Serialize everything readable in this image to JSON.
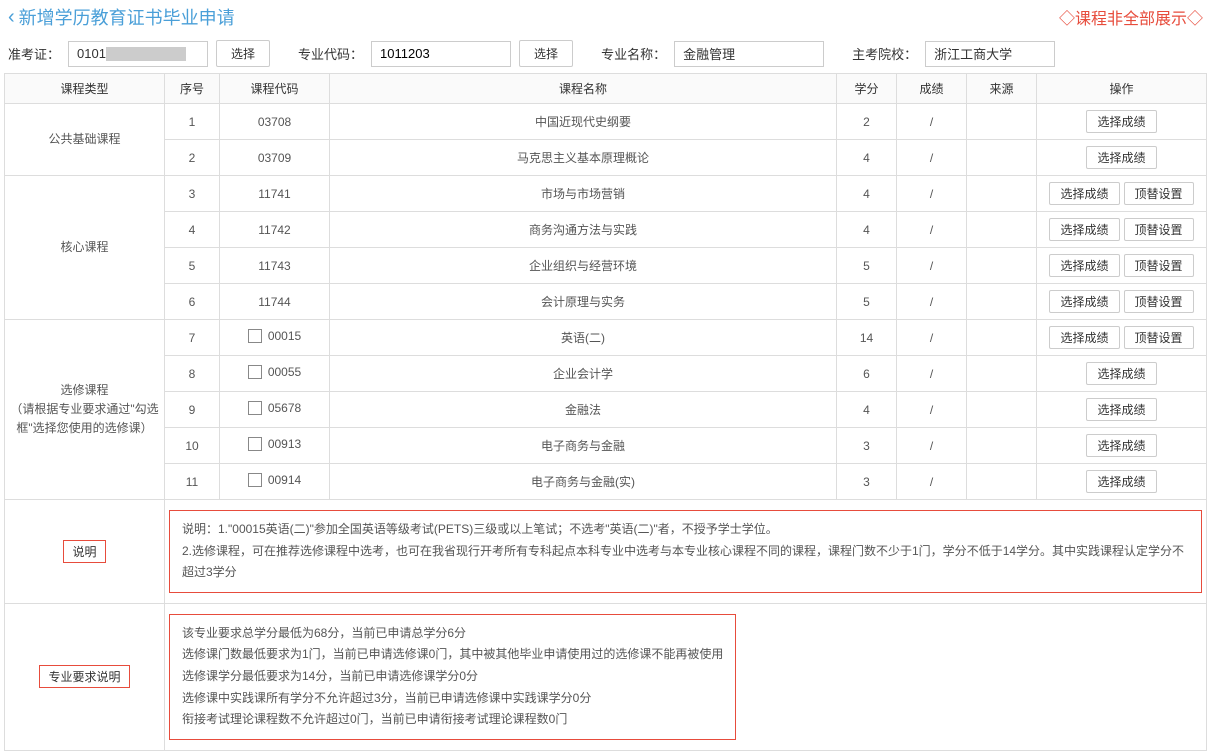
{
  "header": {
    "title": "新增学历教育证书毕业申请",
    "warning": "◇课程非全部展示◇"
  },
  "form": {
    "exam_id_label": "准考证：",
    "exam_id_value": "0101",
    "select_btn": "选择",
    "major_code_label": "专业代码：",
    "major_code_value": "1011203",
    "major_name_label": "专业名称：",
    "major_name_value": "金融管理",
    "school_label": "主考院校：",
    "school_value": "浙江工商大学"
  },
  "table": {
    "headers": {
      "type": "课程类型",
      "seq": "序号",
      "code": "课程代码",
      "name": "课程名称",
      "credit": "学分",
      "score": "成绩",
      "source": "来源",
      "action": "操作"
    },
    "groups": [
      {
        "type": "公共基础课程",
        "rows": [
          {
            "seq": "1",
            "code": "03708",
            "name": "中国近现代史纲要",
            "credit": "2",
            "score": "/",
            "source": "",
            "checkbox": false,
            "sub": false
          },
          {
            "seq": "2",
            "code": "03709",
            "name": "马克思主义基本原理概论",
            "credit": "4",
            "score": "/",
            "source": "",
            "checkbox": false,
            "sub": false
          }
        ]
      },
      {
        "type": "核心课程",
        "rows": [
          {
            "seq": "3",
            "code": "11741",
            "name": "市场与市场营销",
            "credit": "4",
            "score": "/",
            "source": "",
            "checkbox": false,
            "sub": true
          },
          {
            "seq": "4",
            "code": "11742",
            "name": "商务沟通方法与实践",
            "credit": "4",
            "score": "/",
            "source": "",
            "checkbox": false,
            "sub": true
          },
          {
            "seq": "5",
            "code": "11743",
            "name": "企业组织与经营环境",
            "credit": "5",
            "score": "/",
            "source": "",
            "checkbox": false,
            "sub": true
          },
          {
            "seq": "6",
            "code": "11744",
            "name": "会计原理与实务",
            "credit": "5",
            "score": "/",
            "source": "",
            "checkbox": false,
            "sub": true
          }
        ]
      },
      {
        "type": "选修课程\n（请根据专业要求通过\"勾选框\"选择您使用的选修课）",
        "rows": [
          {
            "seq": "7",
            "code": "00015",
            "name": "英语(二)",
            "credit": "14",
            "score": "/",
            "source": "",
            "checkbox": true,
            "sub": true
          },
          {
            "seq": "8",
            "code": "00055",
            "name": "企业会计学",
            "credit": "6",
            "score": "/",
            "source": "",
            "checkbox": true,
            "sub": false
          },
          {
            "seq": "9",
            "code": "05678",
            "name": "金融法",
            "credit": "4",
            "score": "/",
            "source": "",
            "checkbox": true,
            "sub": false
          },
          {
            "seq": "10",
            "code": "00913",
            "name": "电子商务与金融",
            "credit": "3",
            "score": "/",
            "source": "",
            "checkbox": true,
            "sub": false
          },
          {
            "seq": "11",
            "code": "00914",
            "name": "电子商务与金融(实)",
            "credit": "3",
            "score": "/",
            "source": "",
            "checkbox": true,
            "sub": false
          }
        ]
      }
    ],
    "action_select": "选择成绩",
    "action_sub": "顶替设置"
  },
  "notes": {
    "label1": "说明",
    "text1": "说明：1.\"00015英语(二)\"参加全国英语等级考试(PETS)三级或以上笔试；不选考\"英语(二)\"者，不授予学士学位。\n2.选修课程，可在推荐选修课程中选考，也可在我省现行开考所有专科起点本科专业中选考与本专业核心课程不同的课程，课程门数不少于1门，学分不低于14学分。其中实践课程认定学分不超过3学分",
    "label2": "专业要求说明",
    "text2": "该专业要求总学分最低为68分，当前已申请总学分6分\n选修课门数最低要求为1门，当前已申请选修课0门，其中被其他毕业申请使用过的选修课不能再被使用\n选修课学分最低要求为14分，当前已申请选修课学分0分\n选修课中实践课所有学分不允许超过3分，当前已申请选修课中实践课学分0分\n衔接考试理论课程数不允许超过0门，当前已申请衔接考试理论课程数0门"
  }
}
